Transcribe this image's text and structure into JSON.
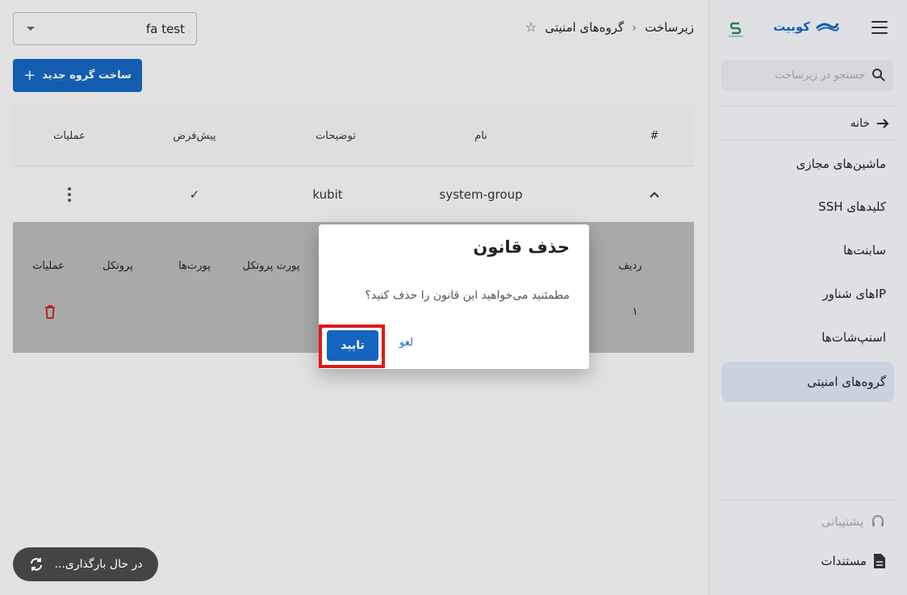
{
  "sidebar": {
    "brand": "کوبیت",
    "search_placeholder": "جستجو در زیرساخت",
    "home": "خانه",
    "items": [
      {
        "label": "ماشین‌های مجازی"
      },
      {
        "label": "کلیدهای SSH"
      },
      {
        "label": "سابنت‌ها"
      },
      {
        "label": "IPهای شناور"
      },
      {
        "label": "اسنپ‌شات‌ها"
      },
      {
        "label": "گروه‌های امنیتی",
        "active": true
      }
    ],
    "support": "پشتیبانی",
    "docs": "مستندات"
  },
  "header": {
    "breadcrumb_parent": "زیرساخت",
    "breadcrumb_separator": "‹",
    "breadcrumb_current": "گروه‌های امنیتی",
    "project": "fa test"
  },
  "create_button": "ساخت گروه جدید",
  "table": {
    "columns": {
      "index": "#",
      "name": "نام",
      "description": "توضیحات",
      "default": "پیش‌فرض",
      "actions": "عملیات"
    },
    "row": {
      "name": "system-group",
      "description": "kubit",
      "default": "✓"
    }
  },
  "rules": {
    "columns": {
      "row": "ردیف",
      "ports": "پورت‌ها",
      "port_protocol": "پورت پروتکل",
      "protocol": "پروتکل",
      "actions": "عملیات"
    },
    "row": {
      "index": "۱"
    }
  },
  "dialog": {
    "title": "حذف قانون",
    "message": "مطمئنید می‌خواهید این قانون را حذف کنید؟",
    "confirm": "تایید",
    "cancel": "لغو"
  },
  "loading": "در حال بارگذاری...",
  "colors": {
    "accent": "#1565c0",
    "danger": "#c62828",
    "highlight": "#e01818"
  }
}
